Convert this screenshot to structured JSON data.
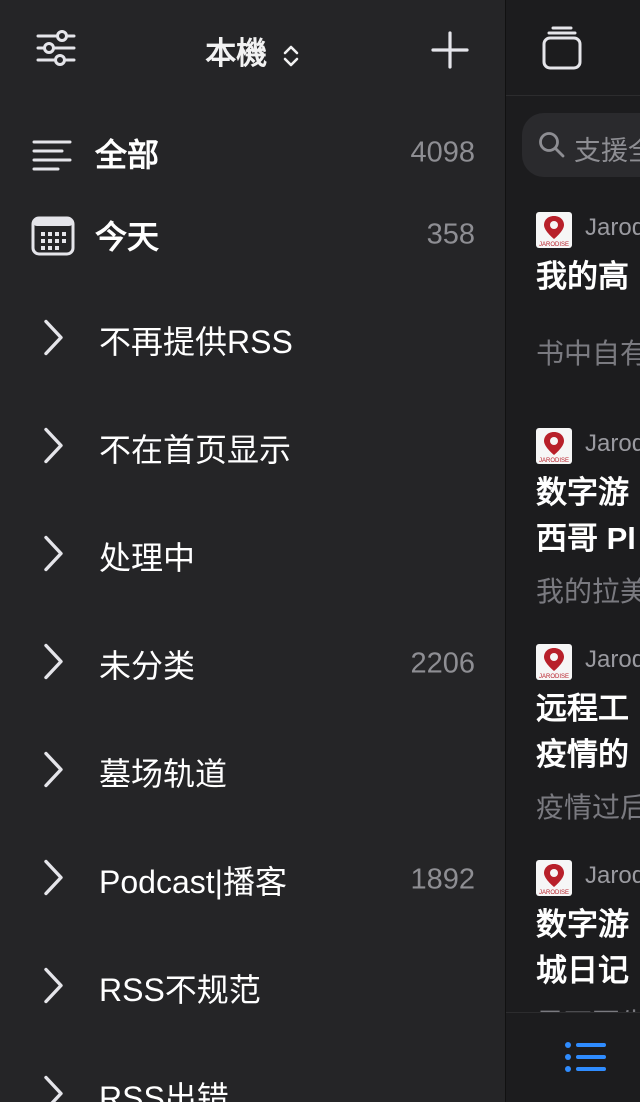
{
  "sidebar": {
    "title": "本機",
    "all": {
      "label": "全部",
      "count": "4098"
    },
    "today": {
      "label": "今天",
      "count": "358"
    },
    "folders": [
      {
        "label": "不再提供RSS",
        "count": ""
      },
      {
        "label": "不在首页显示",
        "count": ""
      },
      {
        "label": "处理中",
        "count": ""
      },
      {
        "label": "未分类",
        "count": "2206"
      },
      {
        "label": "墓场轨道",
        "count": ""
      },
      {
        "label": "Podcast|播客",
        "count": "1892"
      },
      {
        "label": "RSS不规范",
        "count": ""
      },
      {
        "label": "RSS出错",
        "count": ""
      }
    ]
  },
  "list": {
    "search_placeholder": "支援全",
    "articles": [
      {
        "source": "Jarod",
        "title1": "我的高",
        "title2": "",
        "summary": "书中自有"
      },
      {
        "source": "Jarod",
        "title1": "数字游",
        "title2": "西哥 Pl",
        "summary": "我的拉美"
      },
      {
        "source": "Jarod",
        "title1": "远程工",
        "title2": "疫情的",
        "summary": "疫情过后"
      },
      {
        "source": "Jarod",
        "title1": "数字游",
        "title2": "城日记",
        "summary": "墨西哥生"
      }
    ],
    "logo_text": "JARODISE"
  },
  "colors": {
    "accent": "#2f8cff",
    "logo_red": "#b8202a"
  }
}
